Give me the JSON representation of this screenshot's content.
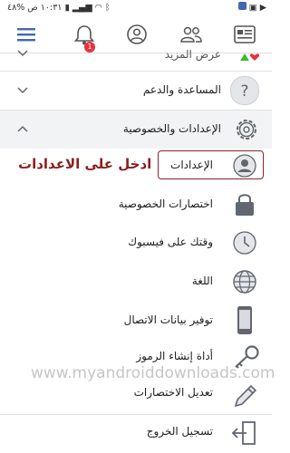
{
  "status_bar": {
    "time": "١٠:٣١ ص",
    "battery": "%٤٨"
  },
  "nav": {
    "notification_count": "1"
  },
  "menu": {
    "partial_item": "عرض المزيد",
    "help_support": "المساعدة والدعم",
    "settings_privacy": "الإعدادات والخصوصية",
    "settings": "الإعدادات",
    "privacy_shortcuts": "اختصارات الخصوصية",
    "time_on_facebook": "وقتك على فيسبوك",
    "language": "اللغة",
    "data_saver": "توفير بيانات الاتصال",
    "code_generator": "أداة إنشاء الرموز",
    "edit_shortcuts": "تعديل الاختصارات",
    "logout": "تسجيل الخروج"
  },
  "annotation": "ادخل على الاعدادات",
  "watermark": "www.myandroiddownloads.com",
  "colors": {
    "facebook_blue": "#4267b2",
    "annotation_red": "#8b1f1f",
    "badge_red": "#e8323c"
  }
}
